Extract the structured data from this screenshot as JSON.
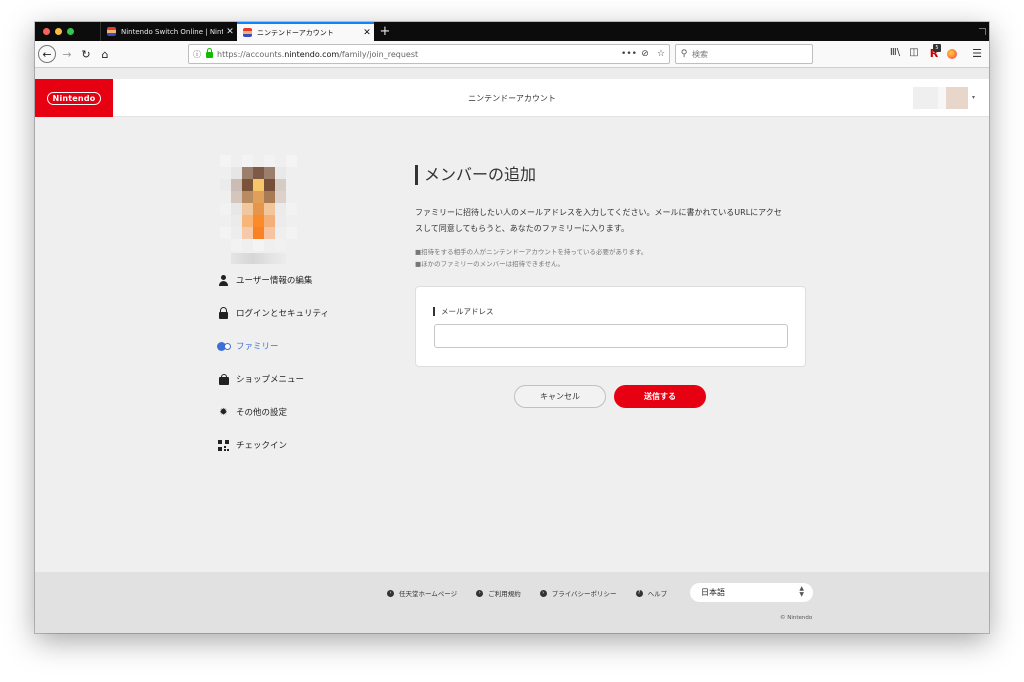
{
  "browser": {
    "tabs": [
      {
        "label": "Nintendo Switch Online | Ninte",
        "close": "✕",
        "active": false
      },
      {
        "label": "ニンテンドーアカウント",
        "close": "✕",
        "active": true
      }
    ],
    "new_tab": "+",
    "nav": {
      "back": "←",
      "forward": "→",
      "reload": "↻",
      "home": "⌂"
    },
    "url": {
      "info": "ⓘ",
      "prefix": "https://accounts.",
      "domain": "nintendo.com",
      "path": "/family/join_request",
      "page_actions": "•••",
      "pocket": "⊘",
      "bookmark": "☆"
    },
    "search": {
      "icon": "⚲",
      "placeholder": "検索"
    },
    "toolbar": {
      "library": "Ⅲ\\",
      "sidebar": "◫",
      "ext_letter": "R",
      "ext_badge": "5",
      "menu": "☰"
    }
  },
  "header": {
    "logo": "Nintendo",
    "title": "ニンテンドーアカウント",
    "caret": "▾"
  },
  "sidebar": {
    "items": [
      {
        "label": "ユーザー情報の編集",
        "icon": "user-icon",
        "active": false
      },
      {
        "label": "ログインとセキュリティ",
        "icon": "lock-icon",
        "active": false
      },
      {
        "label": "ファミリー",
        "icon": "family-icon",
        "active": true
      },
      {
        "label": "ショップメニュー",
        "icon": "shopping-bag-icon",
        "active": false
      },
      {
        "label": "その他の設定",
        "icon": "gear-icon",
        "active": false
      },
      {
        "label": "チェックイン",
        "icon": "qr-code-icon",
        "active": false
      }
    ]
  },
  "main": {
    "heading": "メンバーの追加",
    "description_line1": "ファミリーに招待したい人のメールアドレスを入力してください。メールに書かれているURLにアクセ",
    "description_line2": "スして同意してもらうと、あなたのファミリーに入ります。",
    "note1": "■招待をする相手の人がニンテンドーアカウントを持っている必要があります。",
    "note2": "■ほかのファミリーのメンバーは招待できません。",
    "email_label": "メールアドレス",
    "email_value": "",
    "cancel_label": "キャンセル",
    "submit_label": "送信する"
  },
  "footer": {
    "links": [
      {
        "label": "任天堂ホームページ",
        "icon": "link-arrow-icon"
      },
      {
        "label": "ご利用規約",
        "icon": "link-arrow-icon"
      },
      {
        "label": "プライバシーポリシー",
        "icon": "link-arrow-icon"
      },
      {
        "label": "ヘルプ",
        "icon": "help-icon"
      }
    ],
    "language": "日本語",
    "copyright": "© Nintendo"
  },
  "colors": {
    "brand_red": "#e60012",
    "active_blue": "#3d6fd9",
    "tab_accent": "#0a84ff"
  }
}
